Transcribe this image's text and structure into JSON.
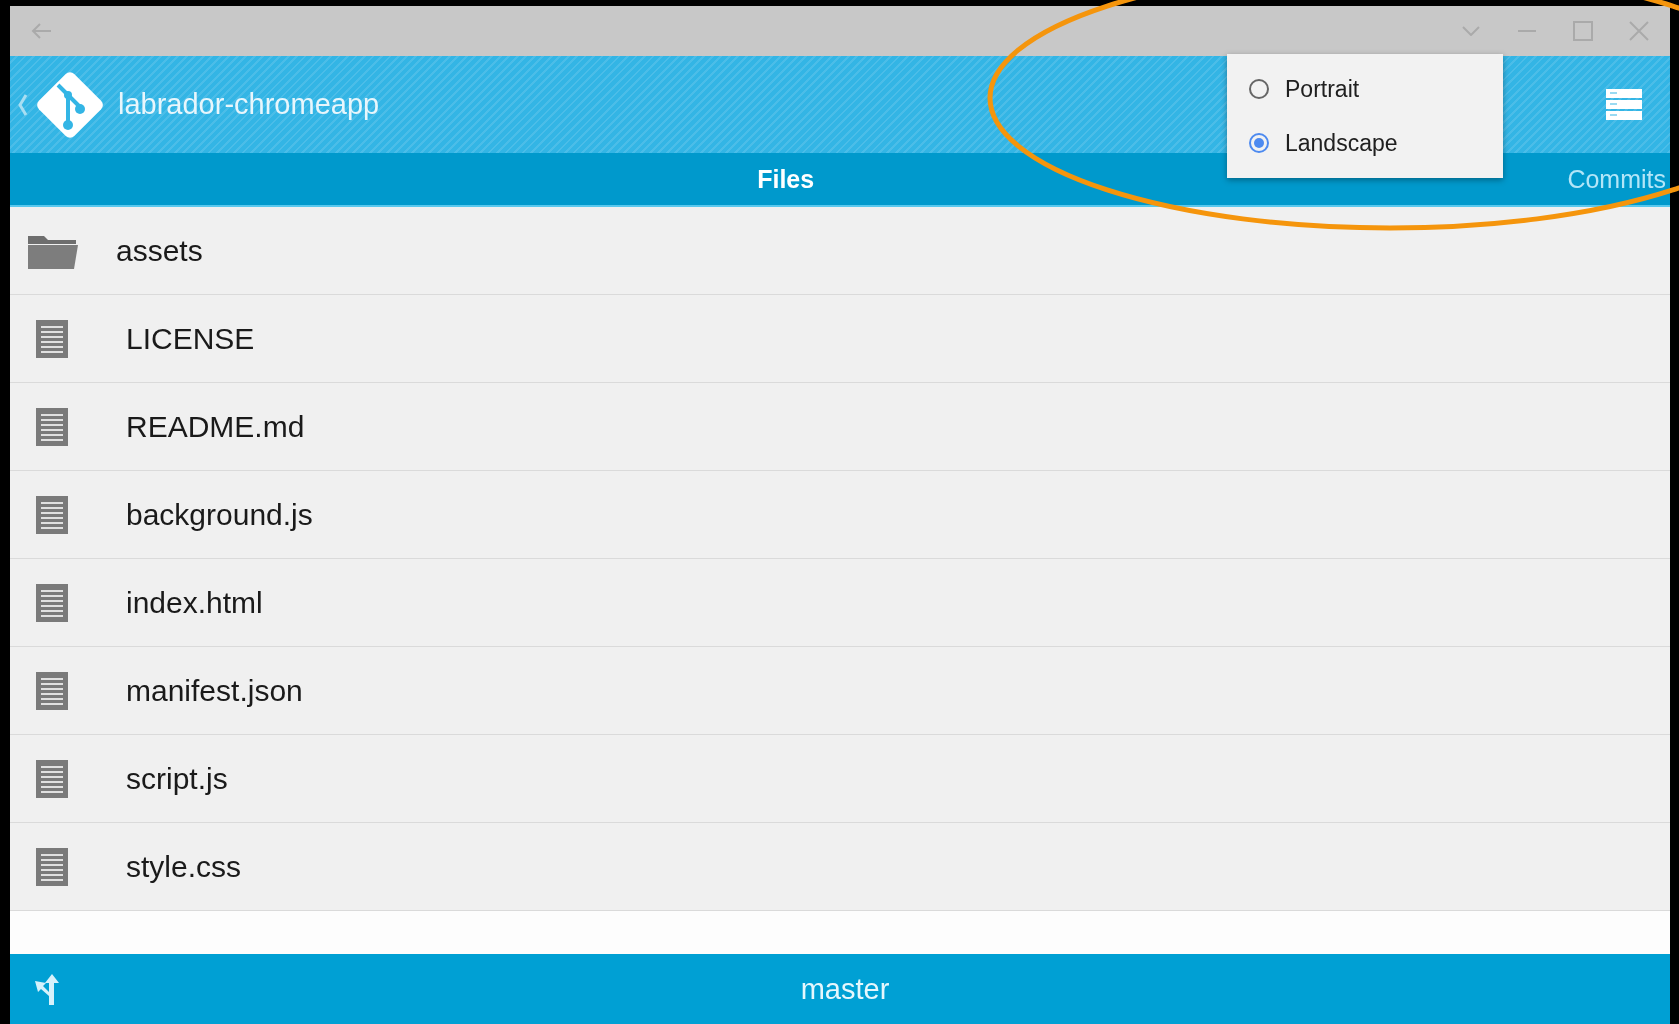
{
  "app_bar": {
    "title": "labrador-chromeapp"
  },
  "tabs": [
    {
      "label": "Files",
      "selected": true
    },
    {
      "label": "Commits",
      "selected": false
    }
  ],
  "files": [
    {
      "name": "assets",
      "kind": "folder"
    },
    {
      "name": "LICENSE",
      "kind": "file"
    },
    {
      "name": "README.md",
      "kind": "file"
    },
    {
      "name": "background.js",
      "kind": "file"
    },
    {
      "name": "index.html",
      "kind": "file"
    },
    {
      "name": "manifest.json",
      "kind": "file"
    },
    {
      "name": "script.js",
      "kind": "file"
    },
    {
      "name": "style.css",
      "kind": "file"
    }
  ],
  "orientation_menu": [
    {
      "label": "Portrait",
      "selected": false
    },
    {
      "label": "Landscape",
      "selected": true
    }
  ],
  "status_bar": {
    "branch": "master"
  }
}
